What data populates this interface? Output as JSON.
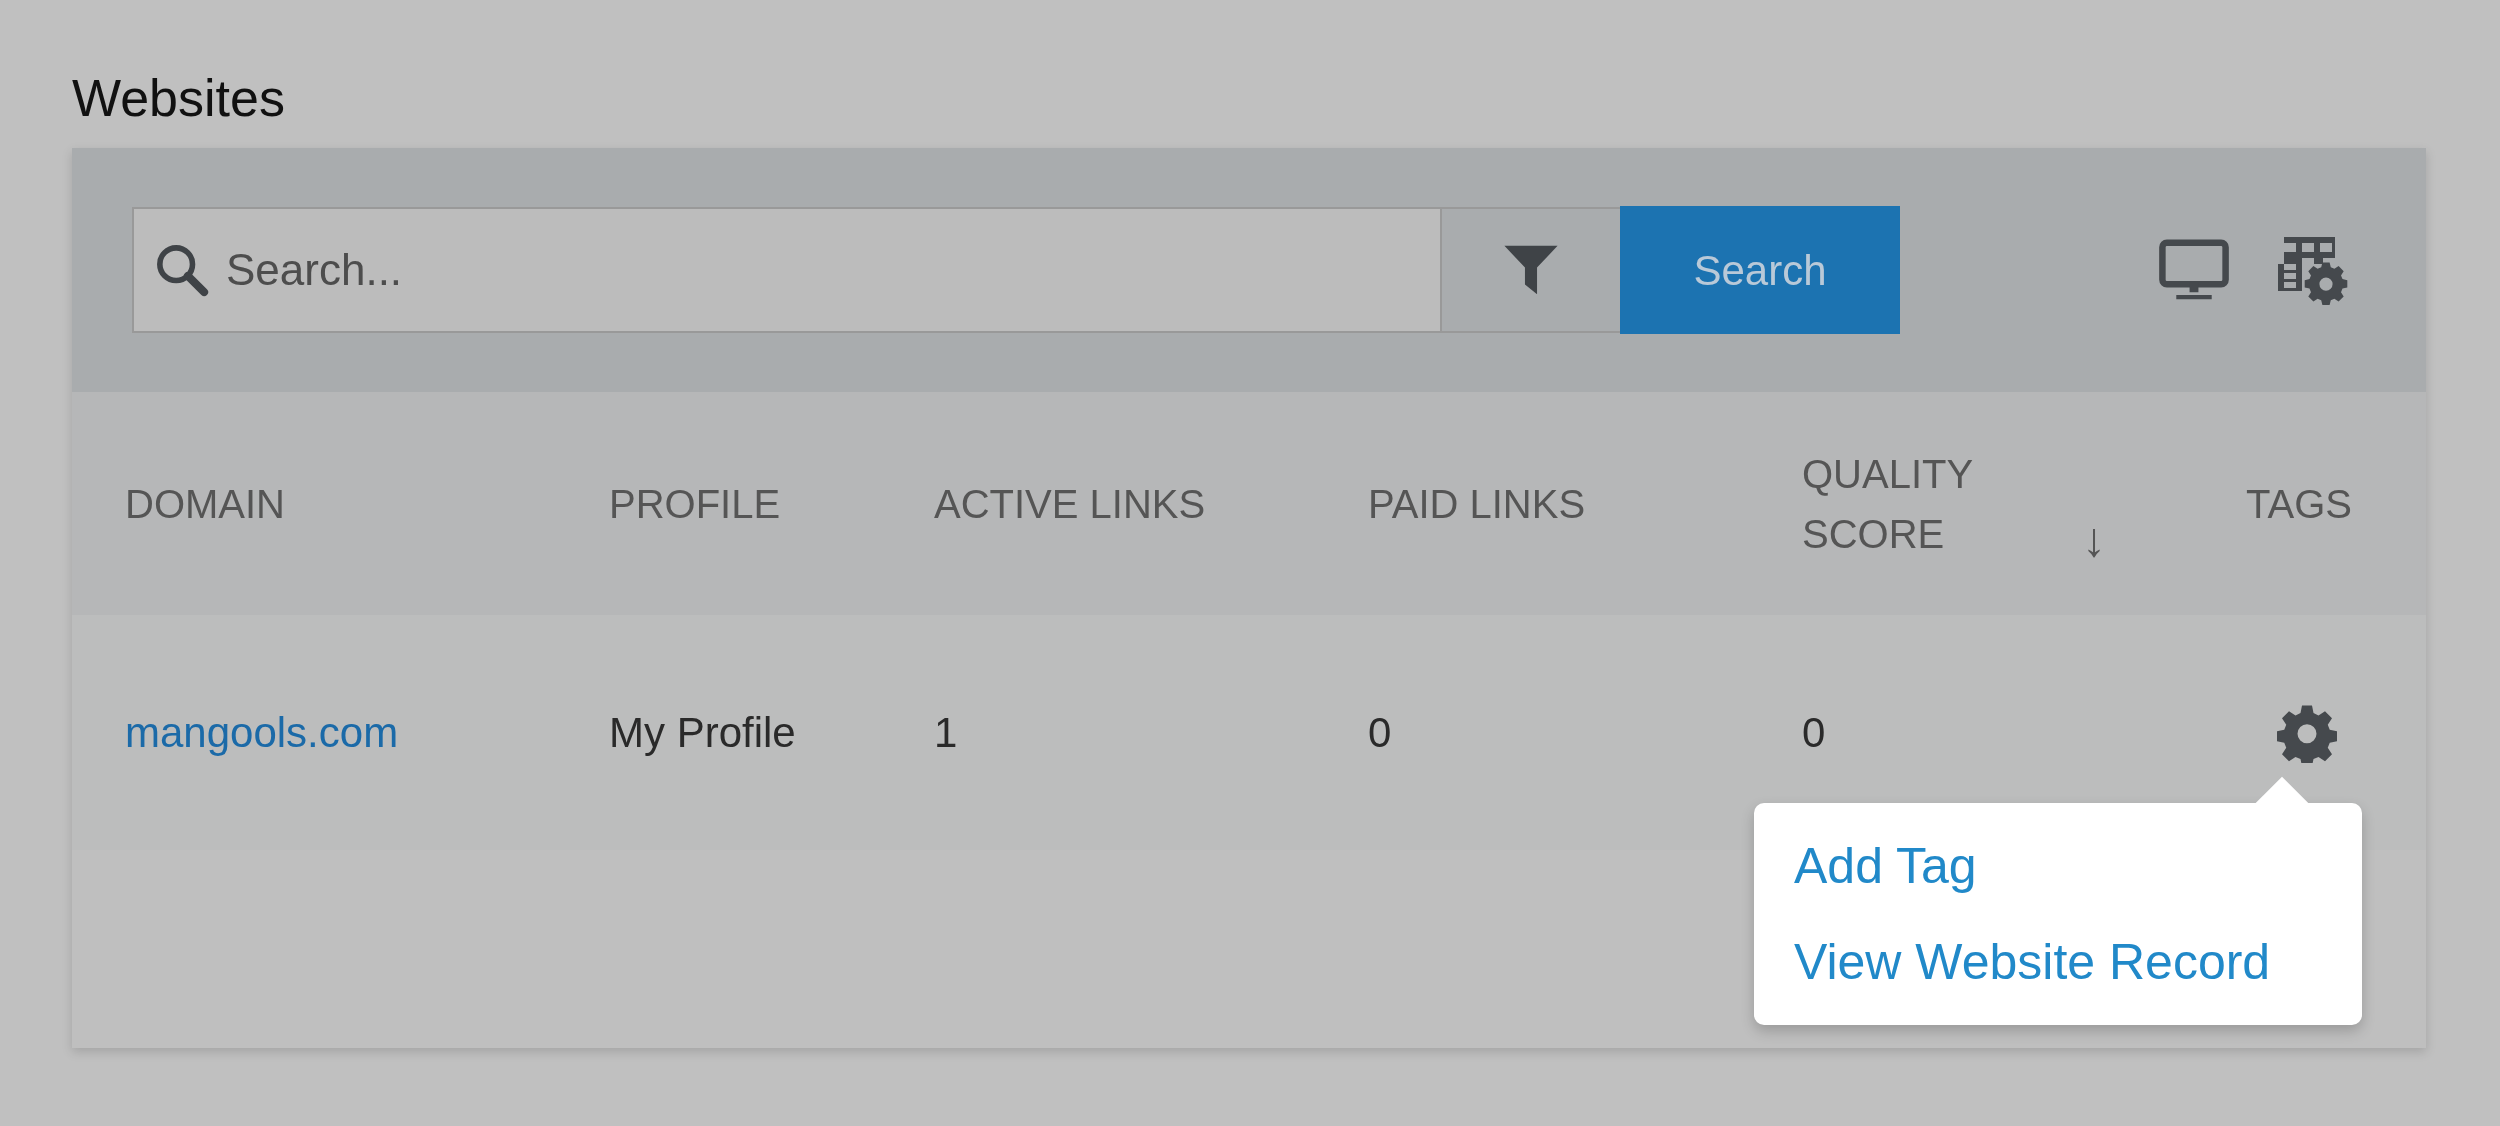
{
  "title": "Websites",
  "search": {
    "placeholder": "Search..."
  },
  "search_button": "Search",
  "table": {
    "columns": [
      {
        "label": "DOMAIN"
      },
      {
        "label": "PROFILE"
      },
      {
        "label": "ACTIVE LINKS"
      },
      {
        "label": "PAID LINKS"
      },
      {
        "label": "QUALITY SCORE",
        "sort_arrow": "↓"
      },
      {
        "label": "TAGS"
      }
    ],
    "rows": [
      {
        "domain": "mangools.com",
        "profile": "My Profile",
        "active_links": "1",
        "paid_links": "0",
        "quality_score": "0"
      }
    ]
  },
  "tag_menu": {
    "items": [
      "Add Tag",
      "View Website Record"
    ]
  }
}
